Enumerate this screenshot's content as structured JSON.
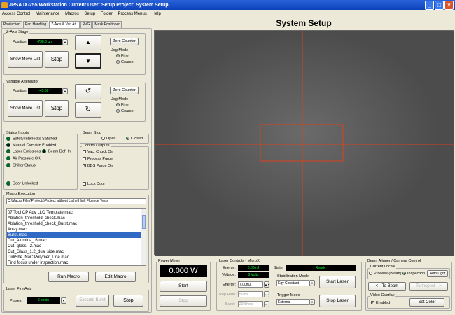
{
  "window": {
    "title": "JPSA IX-255 Workstation   Current User:  Setup      Project:  System Setup"
  },
  "menu": [
    "Access Control",
    "Maintenance",
    "Macros",
    "Setup",
    "Folder",
    "Process Menus",
    "Help"
  ],
  "tabs": [
    "Production",
    "Part Handling",
    "Z-Axis & Var. Att.",
    "RVG",
    "Mask Positioner"
  ],
  "page_title": "System Setup",
  "zaxis": {
    "title": "Z-Axis Stage",
    "position_label": "Position",
    "position_value": "-738.6 µm",
    "show_move_list": "Show Move List",
    "stop": "Stop",
    "up_icon": "▲",
    "down_icon": "▼",
    "zero_counter": "Zero Counter",
    "jog_mode": "Jog Mode",
    "fine": "Fine",
    "coarse": "Coarse"
  },
  "attenuator": {
    "title": "Variable Attenuator",
    "position_label": "Position",
    "position_value": "-45.00 °",
    "show_move_list": "Show Move List",
    "stop": "Stop",
    "ccw_icon": "↺",
    "cw_icon": "↻",
    "zero_counter": "Zero Counter",
    "jog_mode": "Jog Mode",
    "fine": "Fine",
    "coarse": "Coarse"
  },
  "status_inputs": {
    "title": "Status Inputs",
    "items": [
      "Safety Interlocks Satisfied",
      "Manual Override Enabled",
      "Laser Emissions",
      "Air Pressure OK",
      "Chiller Status"
    ],
    "beam_def": "Beam Def. In",
    "door": "Door Unlocked"
  },
  "beam_stop": {
    "title": "Beam Stop",
    "open": "Open",
    "closed": "Closed"
  },
  "control_outputs": {
    "title": "Control Outputs",
    "items": [
      "Vac. Chuck On",
      "Process Purge",
      "BDS Purge On"
    ],
    "lock_door": "Lock Door"
  },
  "macro": {
    "title": "Macro Execution",
    "path": "C:\\Macro Files\\Projects\\Project without Lathe\\High Fluence Tests",
    "items": [
      "07 Tool CP Adv  LLO  Template.mac",
      "Ablation_threshold_check.mac",
      "Ablation_threshold_check_Burst.mac",
      "Array.mac",
      "Burst.mac",
      "Cut_Alumina_.6.mac",
      "Cut_glass_.2.mac",
      "Cut_Glass_1.2_dual side.mac",
      "DidiShe_NaC!Polymer_Line.mac",
      "Find focus under inspection.mac"
    ],
    "selected_index": 4,
    "run": "Run Macro",
    "edit": "Edit Macro"
  },
  "laser_fire": {
    "title": "Laser Fire Axis",
    "pulses_label": "Pulses:",
    "pulses_value": "6 shots",
    "execute_burst": "Execute Burst",
    "stop": "Stop"
  },
  "power_meter": {
    "title": "Power Meter",
    "value": "0.000 W",
    "start": "Start",
    "stop": "Stop"
  },
  "laser_controls": {
    "title": "Laser Controls - MicroX",
    "energy_label": "Energy:",
    "energy_value": "0.00mJ",
    "voltage_label": "Voltage:",
    "voltage_value": "0 Volts",
    "energy_set_label": "Energy:",
    "energy_set_value": "7.00mJ",
    "rep_rate_label": "Rep Rate:",
    "rep_rate_value": "50 Hz",
    "burst_label": "Burst:",
    "burst_value": "20 Shots",
    "state_label": "State:",
    "state_value": "Ready",
    "stab_mode_label": "Stabilization Mode",
    "stab_mode_value": "Egy Constant",
    "trigger_mode_label": "Trigger Mode",
    "trigger_mode_value": "External",
    "start_laser": "Start Laser",
    "stop_laser": "Stop Laser"
  },
  "beam_aligner": {
    "title": "Beam Aligner / Camera Control",
    "locale_label": "Current Locale",
    "process": "Process (Beam)",
    "inspection": "Inspection",
    "auto_light": "Auto Light",
    "to_beam": "<-- To Beam",
    "to_inspect": "To Inspect -->",
    "video_overlay": "Video Overlay",
    "enabled": "Enabled",
    "set_color": "Set Color"
  },
  "colors": {
    "crosshair": "#d9421e",
    "lcd_text": "#00ff33",
    "selection": "#316ac5"
  }
}
